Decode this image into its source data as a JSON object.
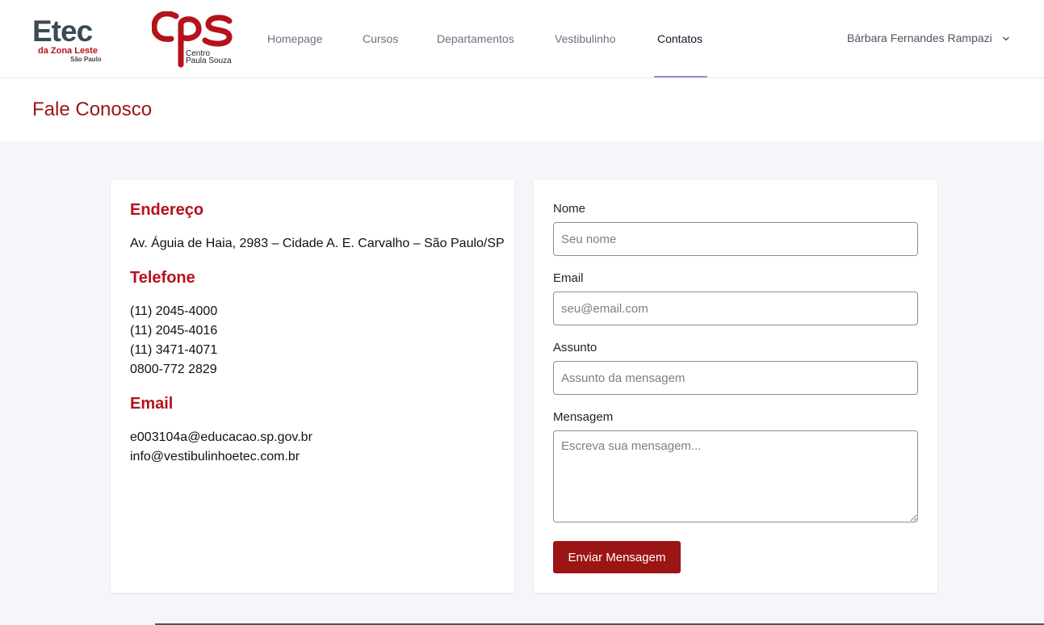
{
  "logos": {
    "etec": {
      "word": "Etec",
      "line1": "da Zona Leste",
      "line2": "São Paulo"
    },
    "cps": {
      "mark": "CPS",
      "line1": "Centro",
      "line2": "Paula Souza"
    }
  },
  "nav": {
    "items": [
      {
        "label": "Homepage",
        "active": false
      },
      {
        "label": "Cursos",
        "active": false
      },
      {
        "label": "Departamentos",
        "active": false
      },
      {
        "label": "Vestibulinho",
        "active": false
      },
      {
        "label": "Contatos",
        "active": true
      }
    ],
    "user_name": "Bárbara Fernandes Rampazi",
    "user_menu_icon": "chevron-down-icon"
  },
  "page": {
    "title": "Fale Conosco"
  },
  "contact_info": {
    "address_title": "Endereço",
    "address": "Av. Águia de Haia, 2983 – Cidade A. E. Carvalho – São Paulo/SP",
    "phone_title": "Telefone",
    "phones": [
      "(11) 2045-4000",
      "(11) 2045-4016",
      "(11) 3471-4071",
      "0800-772 2829"
    ],
    "email_title": "Email",
    "emails": [
      "e003104a@educacao.sp.gov.br",
      "info@vestibulinhoetec.com.br"
    ]
  },
  "form": {
    "name_label": "Nome",
    "name_placeholder": "Seu nome",
    "email_label": "Email",
    "email_placeholder": "seu@email.com",
    "subject_label": "Assunto",
    "subject_placeholder": "Assunto da mensagem",
    "message_label": "Mensagem",
    "message_placeholder": "Escreva sua mensagem...",
    "submit_label": "Enviar Mensagem"
  },
  "colors": {
    "brand_red": "#9b1515",
    "title_red": "#b5121b",
    "active_underline": "#8c93d8",
    "page_bg": "#f5f6f9"
  }
}
